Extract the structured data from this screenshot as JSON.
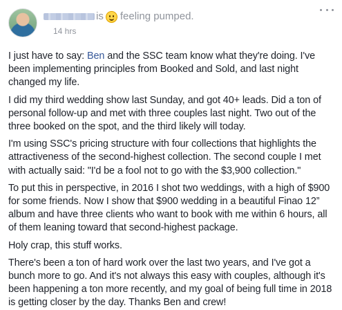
{
  "post": {
    "author_name": "",
    "verb": "is",
    "feeling_icon": "smiling-face-emoji",
    "feeling": "feeling pumped.",
    "timestamp": "14 hrs",
    "more_icon": "ellipsis-icon",
    "p1_before": "I just have to say: ",
    "p1_mention": "Ben",
    "p1_after": " and the SSC team know what they're doing. I've been implementing principles from Booked and Sold, and last night changed my life.",
    "p2": "I did my third wedding show last Sunday, and got 40+ leads. Did a ton of personal follow-up and met with three couples last night. Two out of the three booked on the spot, and the third likely will today.",
    "p3": "I'm using SSC's pricing structure with four collections that highlights the attractiveness of the second-highest collection. The second couple I met with actually said: \"I'd be a fool not to go with the $3,900 collection.\"",
    "p4": "To put this in perspective, in 2016 I shot two weddings, with a high of $900 for some friends. Now I show that $900 wedding in a beautiful Finao 12” album and have three clients who want to book with me within 6 hours, all of them leaning toward that second-highest package.",
    "p5": "Holy crap, this stuff works.",
    "p6": "There's been a ton of hard work over the last two years, and I've got a bunch more to go. And it's not always this easy with couples, although it's been happening a ton more recently, and my goal of being full time in 2018 is getting closer by the day. Thanks Ben and crew!"
  },
  "colors": {
    "text": "#1d2129",
    "meta": "#90949c",
    "link": "#365899",
    "background": "#ffffff"
  }
}
